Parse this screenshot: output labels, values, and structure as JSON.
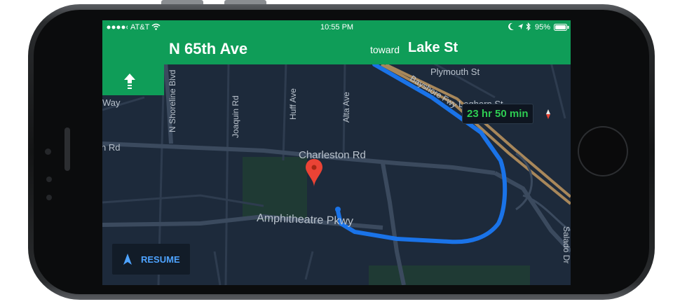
{
  "status_bar": {
    "carrier": "AT&T",
    "time": "10:55 PM",
    "battery": "95%",
    "icons": [
      "signal-dots-icon",
      "wifi-icon",
      "moon-icon",
      "location-icon",
      "bluetooth-icon",
      "battery-icon"
    ]
  },
  "navigation": {
    "street": "N 65th Ave",
    "toward_prefix": "toward",
    "toward_street": "Lake St",
    "maneuver_icon": "straight-arrow-icon"
  },
  "map": {
    "labels": {
      "plymouth": "Plymouth St",
      "bayshore": "Bayshore Fwy",
      "leghorn": "Leghorn St",
      "shoreline": "N Shoreline Blvd",
      "joaquin": "Joaquin Rd",
      "huff": "Huff Ave",
      "alta": "Alta Ave",
      "charleston": "Charleston Rd",
      "amphitheatre": "Amphitheatre Pkwy",
      "salado": "Salado Dr",
      "left_rd": "n Rd",
      "left_way": "Way"
    },
    "eta": "23 hr 50 min",
    "route_color": "#1a73e8",
    "highway_color": "#a8875a",
    "pin_color": "#ea4335"
  },
  "resume_button": {
    "label": "RESUME",
    "icon": "navigation-arrow-icon"
  }
}
